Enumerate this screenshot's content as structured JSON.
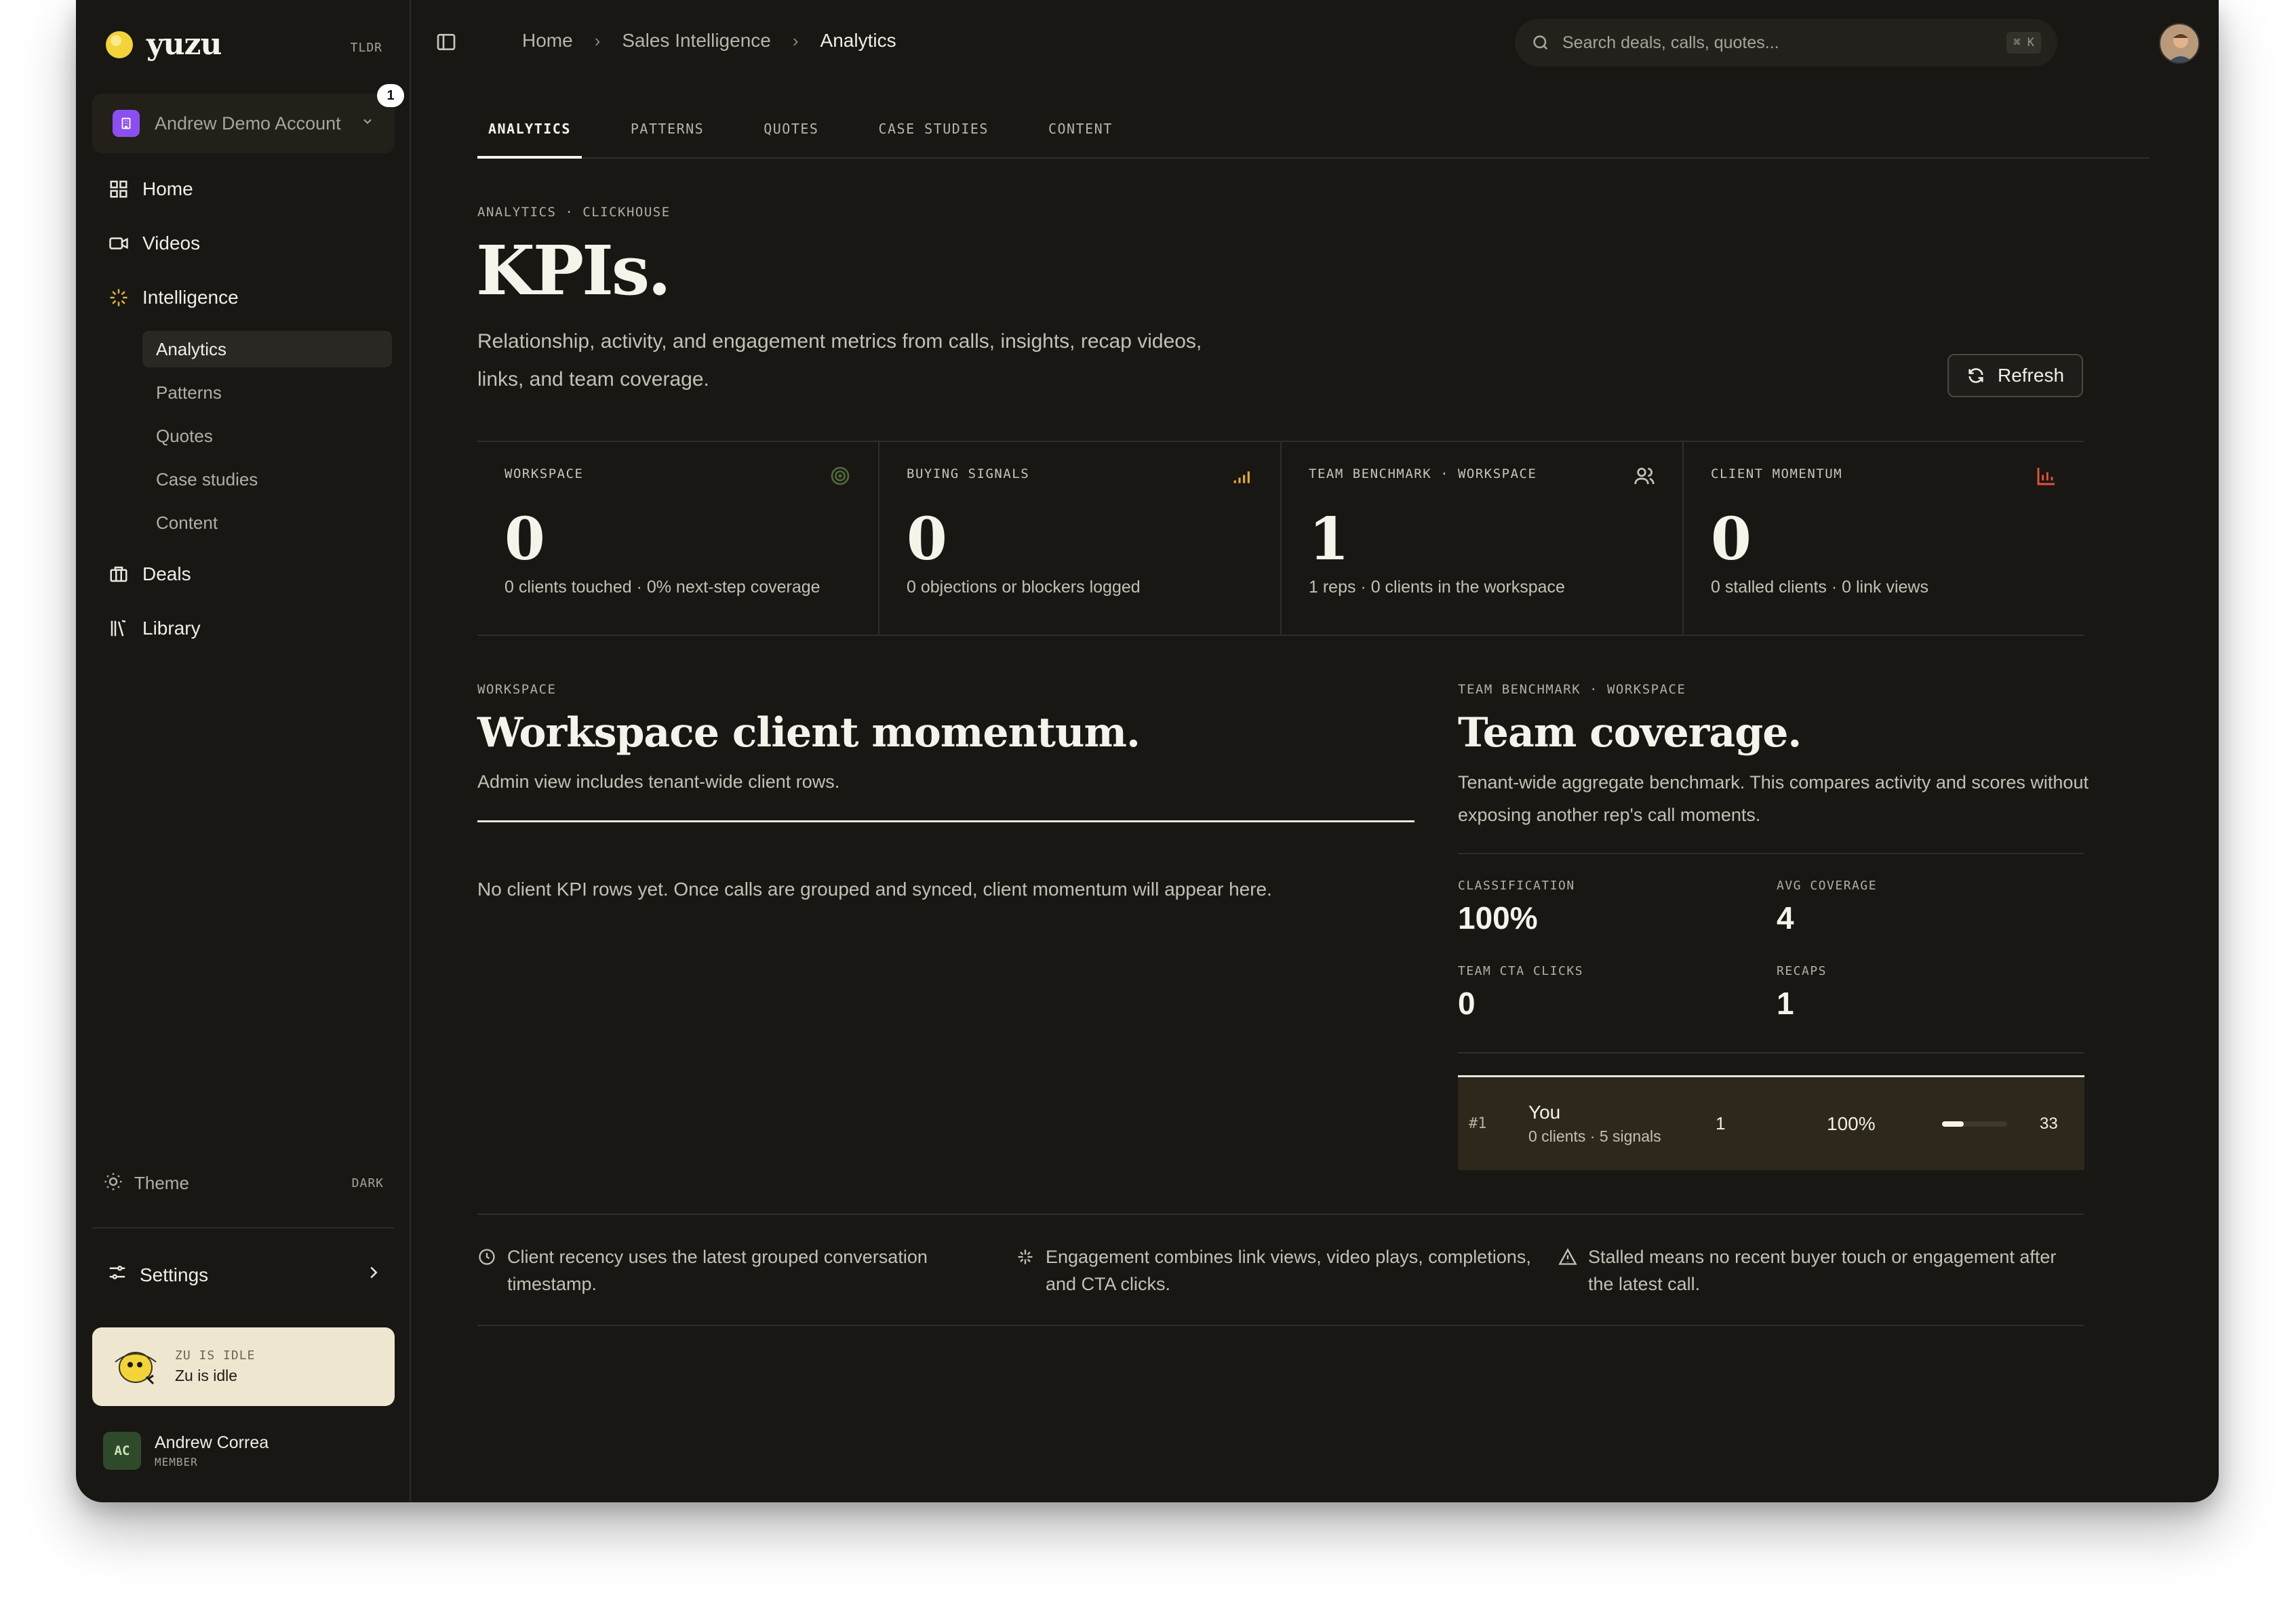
{
  "brand": {
    "name": "yuzu",
    "tldr": "TLDR"
  },
  "account": {
    "name": "Andrew Demo Account",
    "badge": "1"
  },
  "nav": {
    "home": "Home",
    "videos": "Videos",
    "intelligence": "Intelligence",
    "sub_items": [
      "Analytics",
      "Patterns",
      "Quotes",
      "Case studies",
      "Content"
    ],
    "deals": "Deals",
    "library": "Library"
  },
  "theme": {
    "label": "Theme",
    "value": "DARK"
  },
  "settings": {
    "label": "Settings"
  },
  "zu": {
    "status": "ZU IS IDLE",
    "text": "Zu is idle"
  },
  "user": {
    "initials": "AC",
    "name": "Andrew Correa",
    "role": "MEMBER"
  },
  "breadcrumb": [
    "Home",
    "Sales Intelligence",
    "Analytics"
  ],
  "search": {
    "placeholder": "Search deals, calls, quotes...",
    "shortcut": "⌘ K"
  },
  "tabs": [
    "ANALYTICS",
    "PATTERNS",
    "QUOTES",
    "CASE STUDIES",
    "CONTENT"
  ],
  "page": {
    "eyebrow": "ANALYTICS · CLICKHOUSE",
    "title": "KPIs.",
    "description": "Relationship, activity, and engagement metrics from calls, insights, recap videos, links, and team coverage.",
    "refresh_label": "Refresh"
  },
  "kpis": [
    {
      "label": "WORKSPACE",
      "value": "0",
      "sub": "0 clients touched · 0% next-step coverage",
      "icon": "target-icon",
      "color": "#4f6a3a"
    },
    {
      "label": "BUYING SIGNALS",
      "value": "0",
      "sub": "0 objections or blockers logged",
      "icon": "signal-bars-icon",
      "color": "#e0a93a"
    },
    {
      "label": "TEAM BENCHMARK · WORKSPACE",
      "value": "1",
      "sub": "1 reps · 0 clients in the workspace",
      "icon": "users-icon",
      "color": "#c9c5ba"
    },
    {
      "label": "CLIENT MOMENTUM",
      "value": "0",
      "sub": "0 stalled clients · 0 link views",
      "icon": "bar-chart-icon",
      "color": "#e2533a"
    }
  ],
  "workspace": {
    "eyebrow": "WORKSPACE",
    "title": "Workspace client momentum.",
    "description": "Admin view includes tenant-wide client rows.",
    "empty": "No client KPI rows yet. Once calls are grouped and synced, client momentum will appear here."
  },
  "team": {
    "eyebrow": "TEAM BENCHMARK · WORKSPACE",
    "title": "Team coverage.",
    "description": "Tenant-wide aggregate benchmark. This compares activity and scores without exposing another rep's call moments.",
    "stats": [
      {
        "label": "CLASSIFICATION",
        "value": "100%"
      },
      {
        "label": "AVG COVERAGE",
        "value": "4"
      },
      {
        "label": "TEAM CTA CLICKS",
        "value": "0"
      },
      {
        "label": "RECAPS",
        "value": "1"
      }
    ],
    "rows": [
      {
        "rank": "#1",
        "name": "You",
        "sub": "0 clients · 5 signals",
        "reps": "1",
        "pct": "100%",
        "score": "33",
        "score_fraction": 0.33
      }
    ]
  },
  "notes": [
    {
      "icon": "clock-icon",
      "text": "Client recency uses the latest grouped conversation timestamp."
    },
    {
      "icon": "sparkle-icon",
      "text": "Engagement combines link views, video plays, completions, and CTA clicks."
    },
    {
      "icon": "warning-icon",
      "text": "Stalled means no recent buyer touch or engagement after the latest call."
    }
  ]
}
